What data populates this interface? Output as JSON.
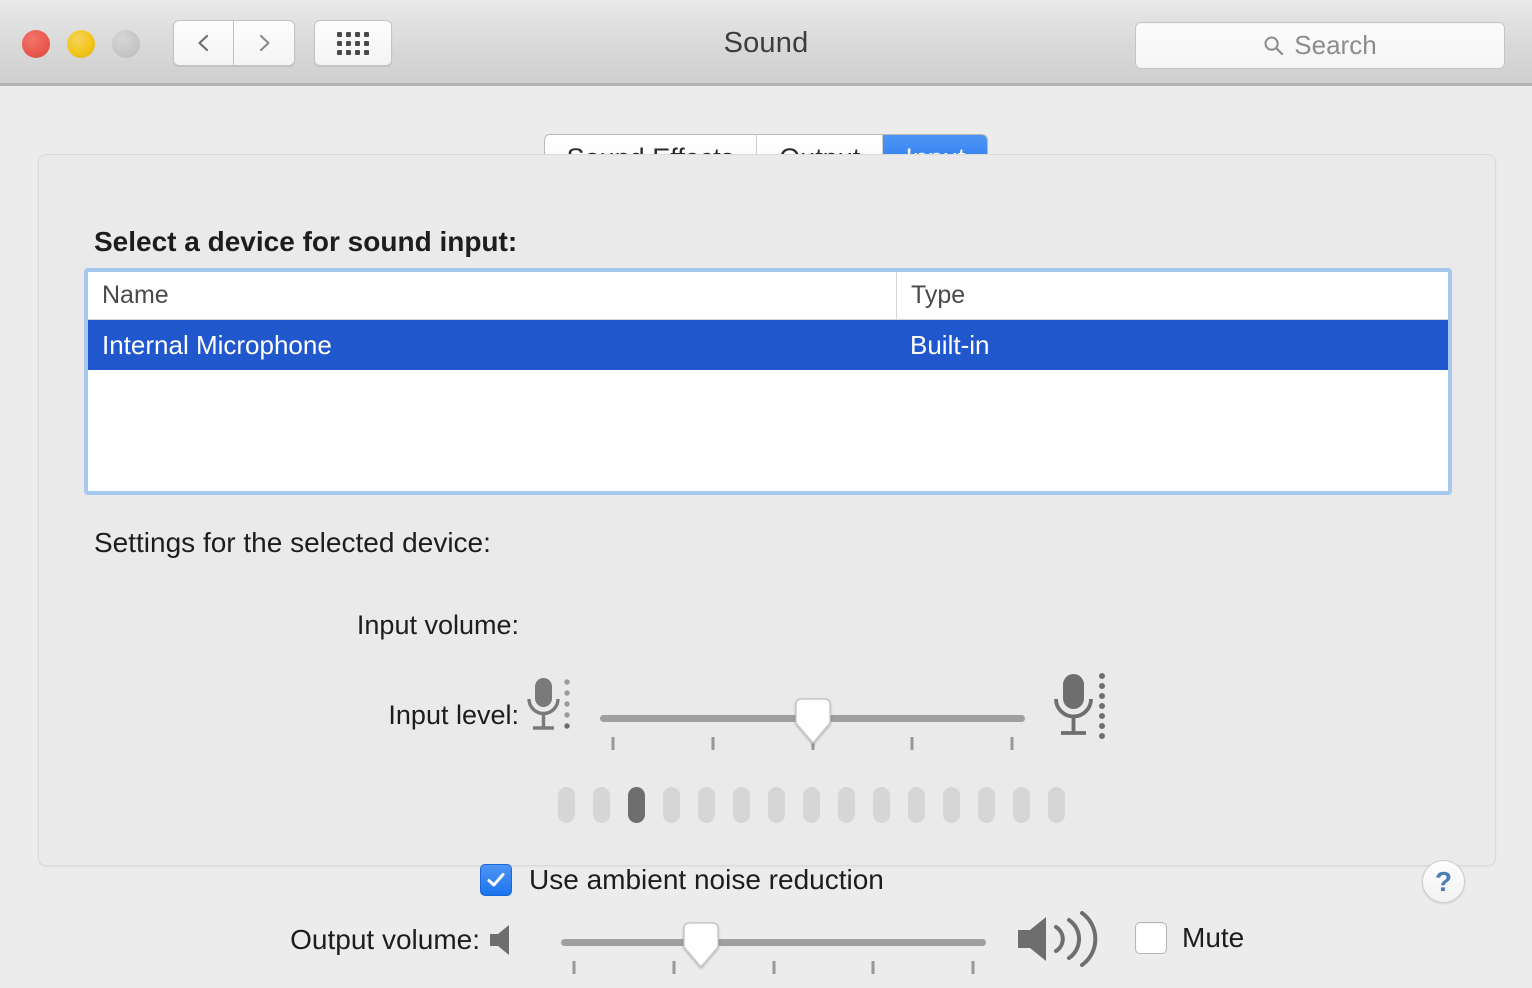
{
  "window": {
    "title": "Sound",
    "traffic_lights": [
      "close",
      "minimize",
      "zoom"
    ],
    "nav": {
      "back_icon": "chevron-left-icon",
      "forward_icon": "chevron-right-icon"
    },
    "show_all_icon": "grid-icon"
  },
  "search": {
    "icon": "search-icon",
    "placeholder": "Search",
    "value": ""
  },
  "tabs": [
    {
      "label": "Sound Effects",
      "selected": false
    },
    {
      "label": "Output",
      "selected": false
    },
    {
      "label": "Input",
      "selected": true
    }
  ],
  "panel": {
    "select_device_label": "Select a device for sound input:",
    "table": {
      "columns": [
        "Name",
        "Type"
      ],
      "rows": [
        {
          "name": "Internal Microphone",
          "type": "Built-in",
          "selected": true
        }
      ]
    },
    "settings_label": "Settings for the selected device:",
    "input_volume": {
      "label": "Input volume:",
      "value_percent": 50,
      "tick_count": 5,
      "min_icon": "microphone-low-icon",
      "max_icon": "microphone-high-icon"
    },
    "input_level": {
      "label": "Input level:",
      "segment_count": 15,
      "active_segments": 3,
      "lit_index": 3
    },
    "ambient_noise": {
      "label": "Use ambient noise reduction",
      "checked": true
    },
    "help_button": {
      "glyph": "?",
      "icon": "help-icon"
    }
  },
  "output_volume": {
    "label": "Output volume:",
    "value_percent": 33,
    "tick_count": 5,
    "min_icon": "speaker-quiet-icon",
    "max_icon": "speaker-loud-icon",
    "mute": {
      "label": "Mute",
      "checked": false
    }
  },
  "colors": {
    "accent_blue": "#1d74ef",
    "selection_blue": "#2157cc",
    "focus_ring": "#a6c8ee",
    "window_bg": "#ececec",
    "panel_bg": "#eaeaea",
    "help_glyph": "#4a7fb5"
  }
}
